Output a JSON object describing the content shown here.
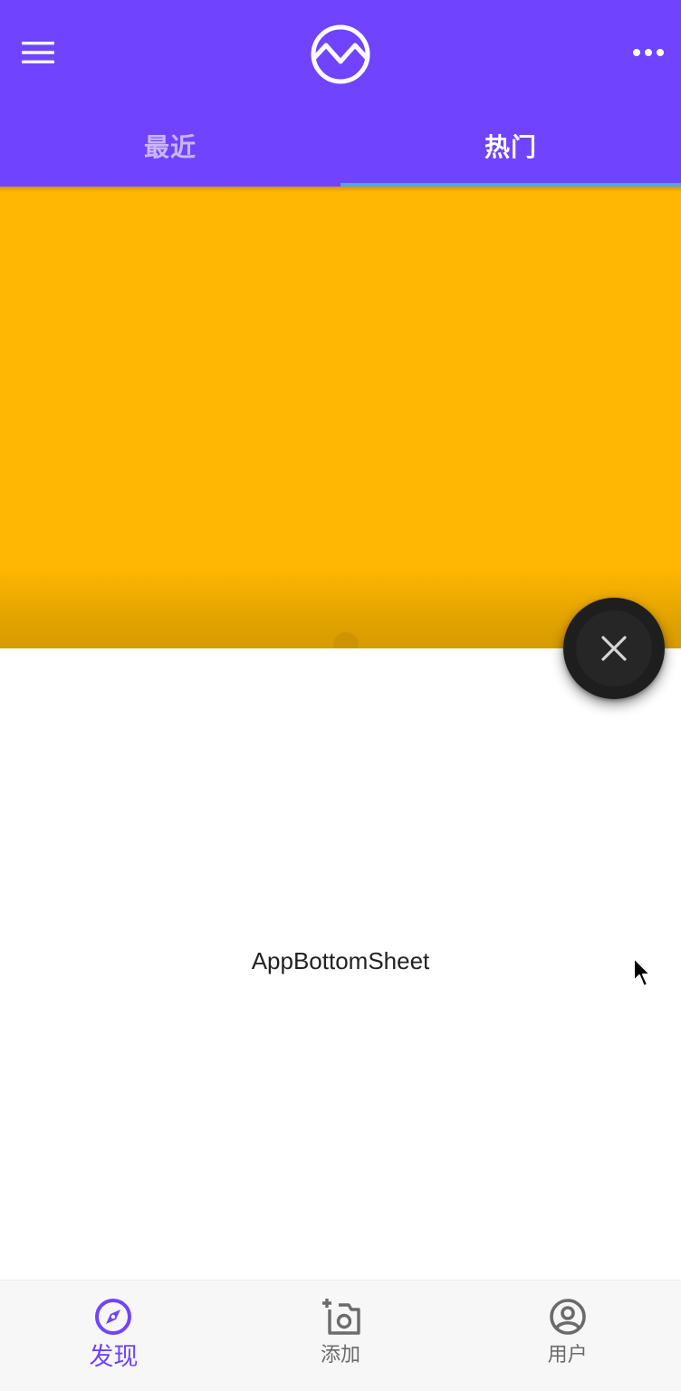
{
  "colors": {
    "primary": "#7044ff",
    "tab_inactive": "#c9b6ff",
    "tab_indicator": "#4da8e8",
    "content_yellow": "#ffb703",
    "fab_background": "#1e1e1e",
    "nav_inactive": "#6b6b6b"
  },
  "app_bar": {
    "menu_icon": "hamburger-menu-icon",
    "logo_icon": "wave-circle-logo",
    "more_icon": "more-horizontal-icon"
  },
  "tabs": [
    {
      "label": "最近",
      "active": false
    },
    {
      "label": "热门",
      "active": true
    }
  ],
  "sheet": {
    "label": "AppBottomSheet"
  },
  "fab": {
    "icon": "close-icon"
  },
  "bottom_nav": [
    {
      "label": "发现",
      "icon": "compass-icon",
      "active": true
    },
    {
      "label": "添加",
      "icon": "add-photo-icon",
      "active": false
    },
    {
      "label": "用户",
      "icon": "account-circle-icon",
      "active": false
    }
  ]
}
